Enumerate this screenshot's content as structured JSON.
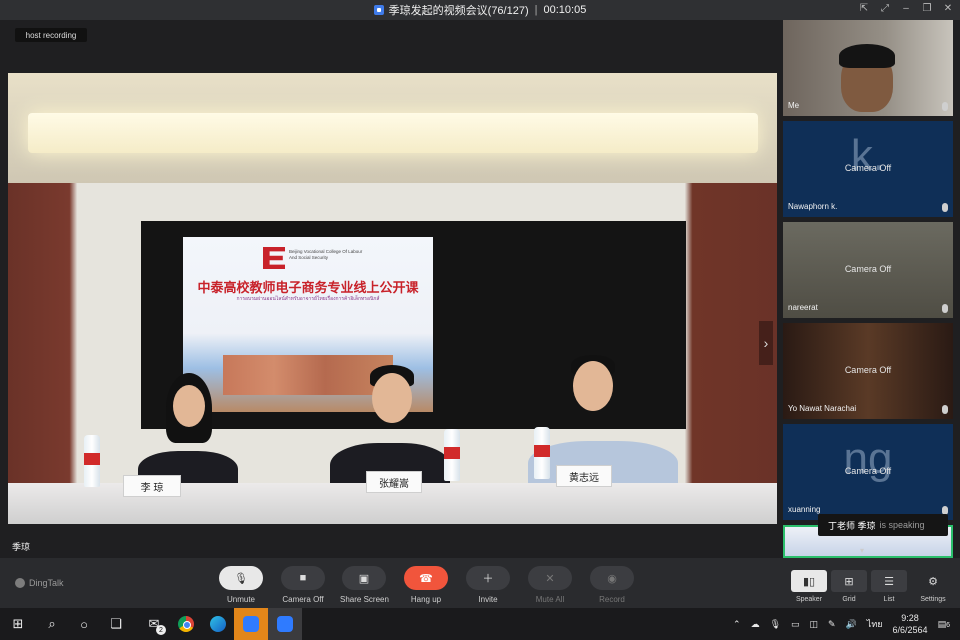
{
  "window": {
    "title": "季琼发起的视频会议(76/127)",
    "timer": "00:10:05"
  },
  "stage": {
    "host_recording": "host recording",
    "active_speaker_name": "季琼",
    "slide": {
      "college": "Beijing Vocational College Of Labour And Social Security",
      "title": "中泰高校教师电子商务专业线上公开课",
      "subtitle": "การอบรมผ่านออนไลน์สำหรับอาจารย์ไทยเรื่องการค้าอิเล็กทรอนิกส์"
    },
    "nameplates": [
      "李 琼",
      "张耀嵩",
      "黄志远"
    ]
  },
  "participants": [
    {
      "name": "Me",
      "camera": "",
      "initial": "",
      "style": "me"
    },
    {
      "name": "Nawaphorn k.",
      "camera": "Camera Off",
      "initial": "k.",
      "style": "plain"
    },
    {
      "name": "nareerat",
      "camera": "Camera Off",
      "initial": "",
      "style": "photo1"
    },
    {
      "name": "Yo Nawat Narachai",
      "camera": "Camera Off",
      "initial": "",
      "style": "photo2"
    },
    {
      "name": "xuanning",
      "camera": "Camera Off",
      "initial": "ng",
      "style": "plain"
    }
  ],
  "speaking_toast": {
    "names": "丁老师  季琼",
    "suffix": "is speaking"
  },
  "brand": "DingTalk",
  "toolbar": {
    "unmute": "Unmute",
    "camera_off": "Camera Off",
    "share_screen": "Share Screen",
    "hang_up": "Hang up",
    "invite": "Invite",
    "mute_all": "Mute All",
    "record": "Record"
  },
  "view_modes": {
    "speaker": "Speaker",
    "grid": "Grid",
    "list": "List",
    "settings": "Settings"
  },
  "taskbar": {
    "mail_badge": "2",
    "lang": "ไทย",
    "time": "9:28",
    "date": "6/6/2564",
    "notifications": "6"
  },
  "colors": {
    "accent_red": "#f1553c",
    "tile_blue": "#0f2f57",
    "active_border": "#2bbf6b"
  }
}
